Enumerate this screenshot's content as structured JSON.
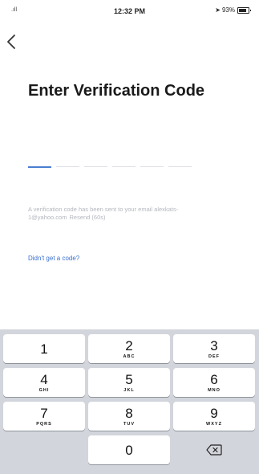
{
  "status_bar": {
    "signal": ".ıll",
    "time": "12:32 PM",
    "battery": "93%"
  },
  "nav": {
    "back_icon": "chevron-left-icon"
  },
  "title": "Enter Verification Code",
  "code": {
    "length": 6,
    "entered": ""
  },
  "info": {
    "message": "A verification code has been sent to your email alexkats-1@yahoo.com",
    "resend": "Resend (60s)"
  },
  "help_link": "Didn't get a code?",
  "keypad": {
    "keys": [
      {
        "digit": "1",
        "letters": ""
      },
      {
        "digit": "2",
        "letters": "ABC"
      },
      {
        "digit": "3",
        "letters": "DEF"
      },
      {
        "digit": "4",
        "letters": "GHI"
      },
      {
        "digit": "5",
        "letters": "JKL"
      },
      {
        "digit": "6",
        "letters": "MNO"
      },
      {
        "digit": "7",
        "letters": "PQRS"
      },
      {
        "digit": "8",
        "letters": "TUV"
      },
      {
        "digit": "9",
        "letters": "WXYZ"
      },
      {
        "digit": "0",
        "letters": ""
      }
    ],
    "delete_icon": "backspace-icon"
  },
  "colors": {
    "accent": "#3a6fd0",
    "keypad_bg": "#d2d5db",
    "muted_text": "#b3b7bd"
  }
}
